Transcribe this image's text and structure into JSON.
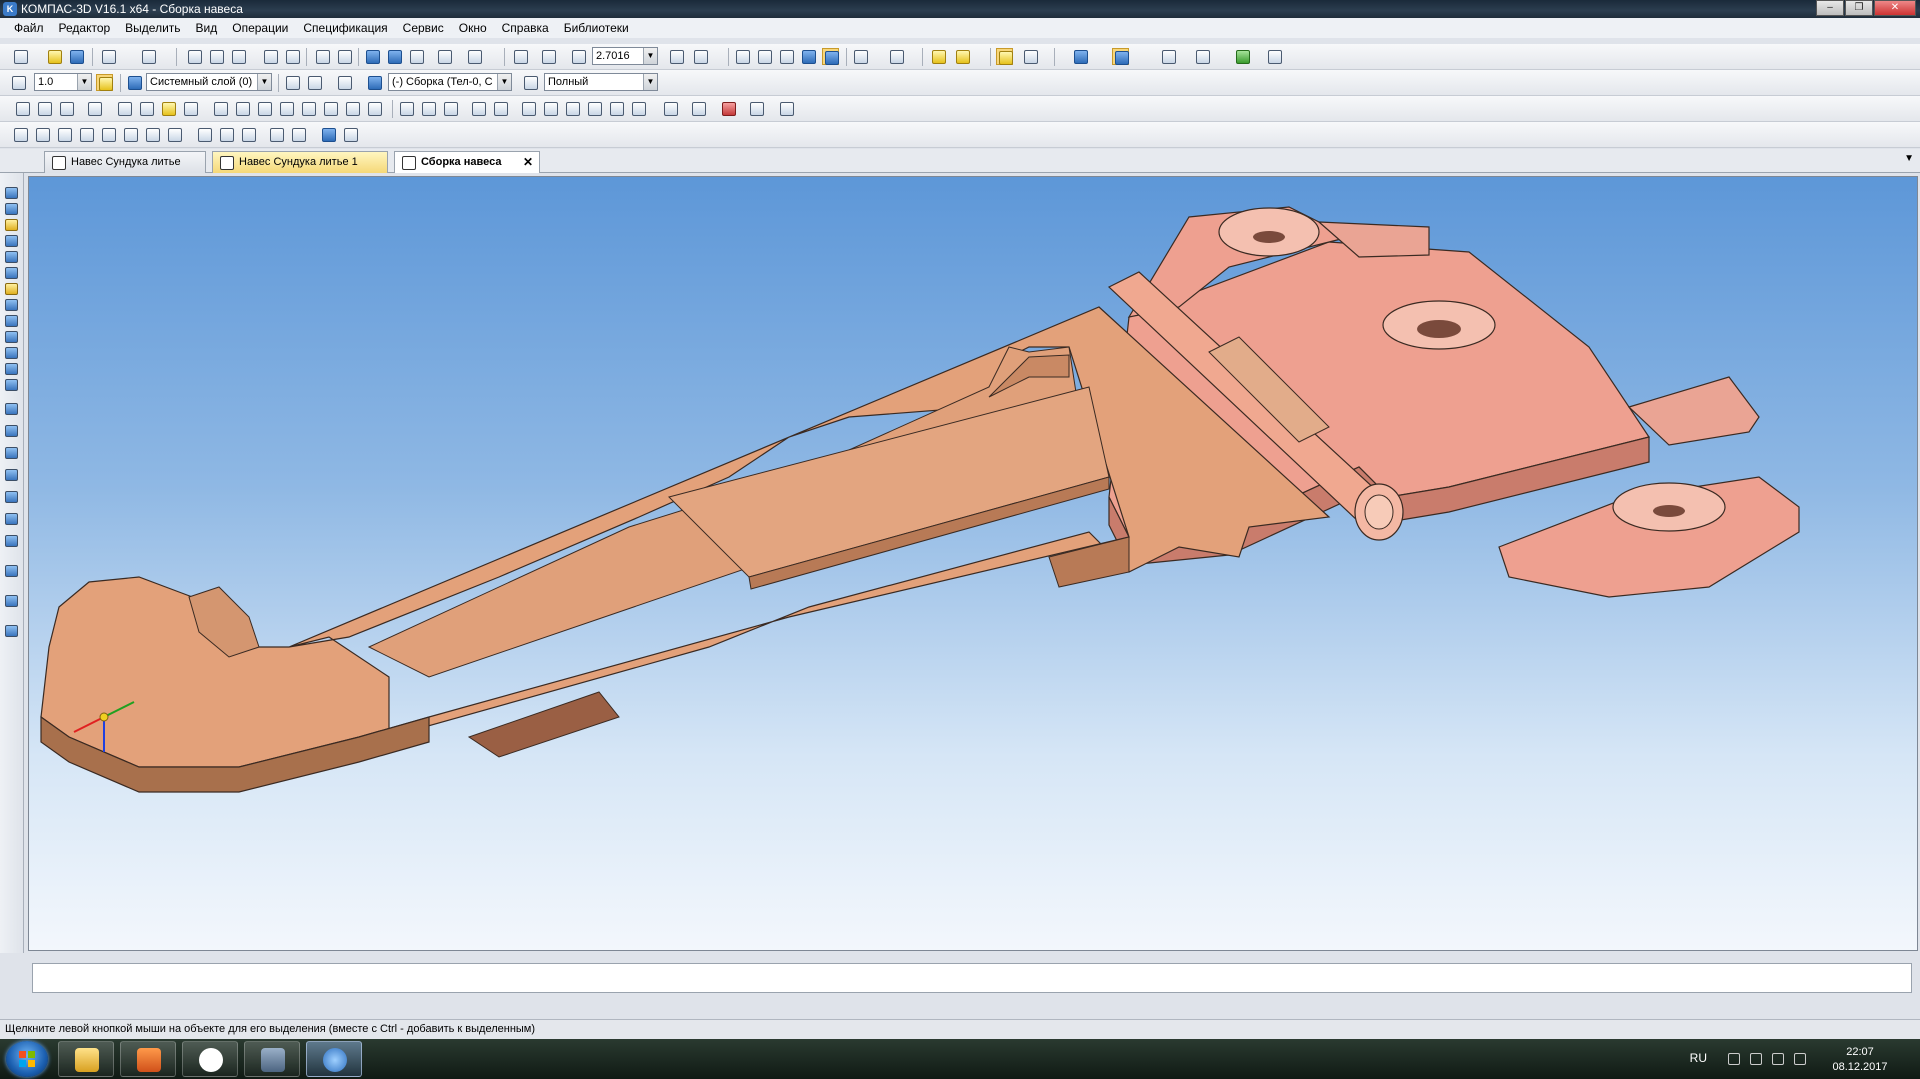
{
  "window": {
    "title": "КОМПАС-3D V16.1 x64 - Сборка навеса"
  },
  "menu": {
    "items": [
      "Файл",
      "Редактор",
      "Выделить",
      "Вид",
      "Операции",
      "Спецификация",
      "Сервис",
      "Окно",
      "Справка",
      "Библиотеки"
    ]
  },
  "toolbar": {
    "zoom_value": "2.7016",
    "step_value": "1.0",
    "layer_value": "Системный слой (0)",
    "context_value": "(-) Сборка (Тел-0, С",
    "view_mode_value": "Полный"
  },
  "tabs": [
    {
      "label": "Навес Сундука литье",
      "state": "normal"
    },
    {
      "label": "Навес Сундука литье 1",
      "state": "highlighted"
    },
    {
      "label": "Сборка навеса",
      "state": "active"
    }
  ],
  "status_text": "Щелкните левой кнопкой мыши на объекте для его выделения (вместе с Ctrl - добавить к выделенным)",
  "tray": {
    "language": "RU",
    "time": "22:07",
    "date": "08.12.2017"
  },
  "colors": {
    "part_front": "#e3a17a",
    "part_back": "#eea090",
    "sky_top": "#5d97d8",
    "sky_bottom": "#f3f7fc"
  }
}
